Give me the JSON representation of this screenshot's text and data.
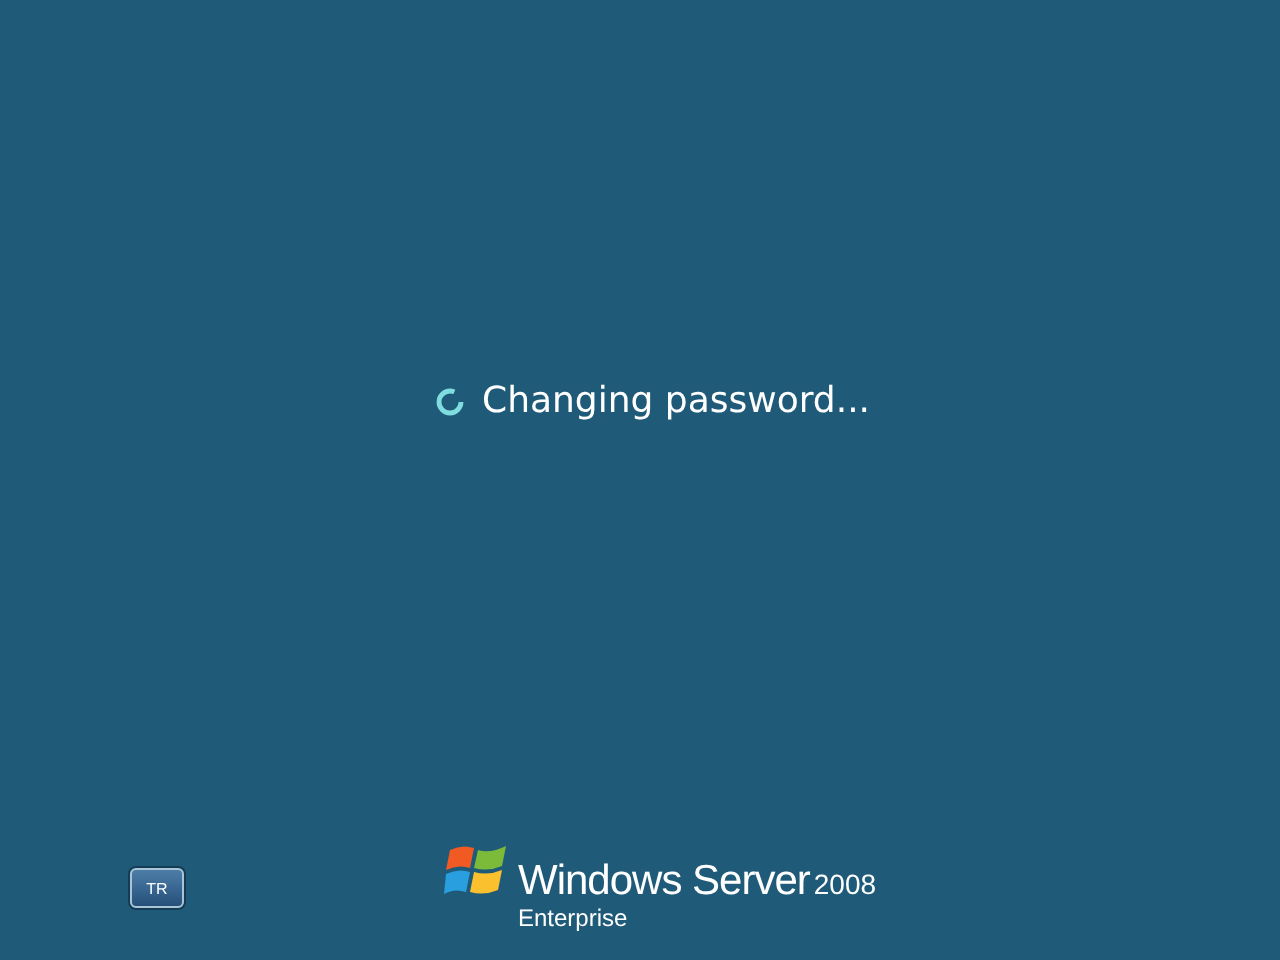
{
  "status": {
    "message": "Changing password..."
  },
  "language_button": {
    "label": "TR"
  },
  "logo": {
    "product": "Windows Server",
    "version": "2008",
    "edition": "Enterprise"
  }
}
